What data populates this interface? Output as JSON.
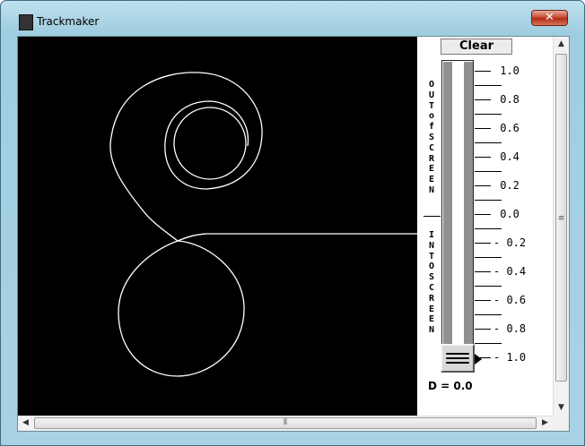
{
  "window": {
    "title": "Trackmaker",
    "close_glyph": "✕"
  },
  "panel": {
    "clear_label": "Clear",
    "out_of_screen": "OUT of SCREEN",
    "into_screen": "INTO SCREEN",
    "scale_labels": [
      " 1.0",
      " 0.8",
      " 0.6",
      " 0.4",
      " 0.2",
      " 0.0",
      "- 0.2",
      "- 0.4",
      "- 0.6",
      "- 0.8",
      "- 1.0"
    ],
    "d_readout": "D = 0.0",
    "slider_value": -1.0
  },
  "scrollbars": {
    "up_glyph": "▲",
    "down_glyph": "▼",
    "left_glyph": "◀",
    "right_glyph": "▶",
    "grip_glyph": "≡",
    "hgrip_glyph": "⦀"
  },
  "colors": {
    "canvas_bg": "#000000",
    "track_stroke": "#ffffff",
    "titlebar": "#a9d3e4",
    "close": "#c3442a"
  },
  "icons": {
    "app": "trackmaker-app-icon"
  }
}
